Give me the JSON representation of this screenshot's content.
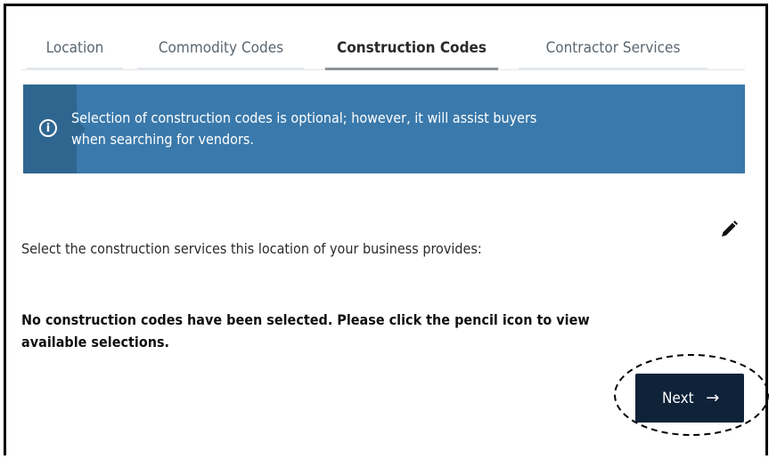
{
  "tabs": [
    {
      "label": "Location",
      "active": false
    },
    {
      "label": "Commodity Codes",
      "active": false
    },
    {
      "label": "Construction Codes",
      "active": true
    },
    {
      "label": "Contractor Services",
      "active": false
    }
  ],
  "banner": {
    "icon": "info-circle-icon",
    "line1": "Selection of construction codes is optional; however, it will assist buyers",
    "line2": "when searching for vendors.",
    "color": "#3a79ab"
  },
  "prompt": "Select the construction services this location of your business provides:",
  "edit_icon": "pencil-icon",
  "empty_message": {
    "line1": "No construction codes have been selected. Please click the pencil icon to view",
    "line2": "available selections."
  },
  "next_button": {
    "label": "Next",
    "icon": "arrow-right-icon",
    "color": "#0e2238"
  }
}
